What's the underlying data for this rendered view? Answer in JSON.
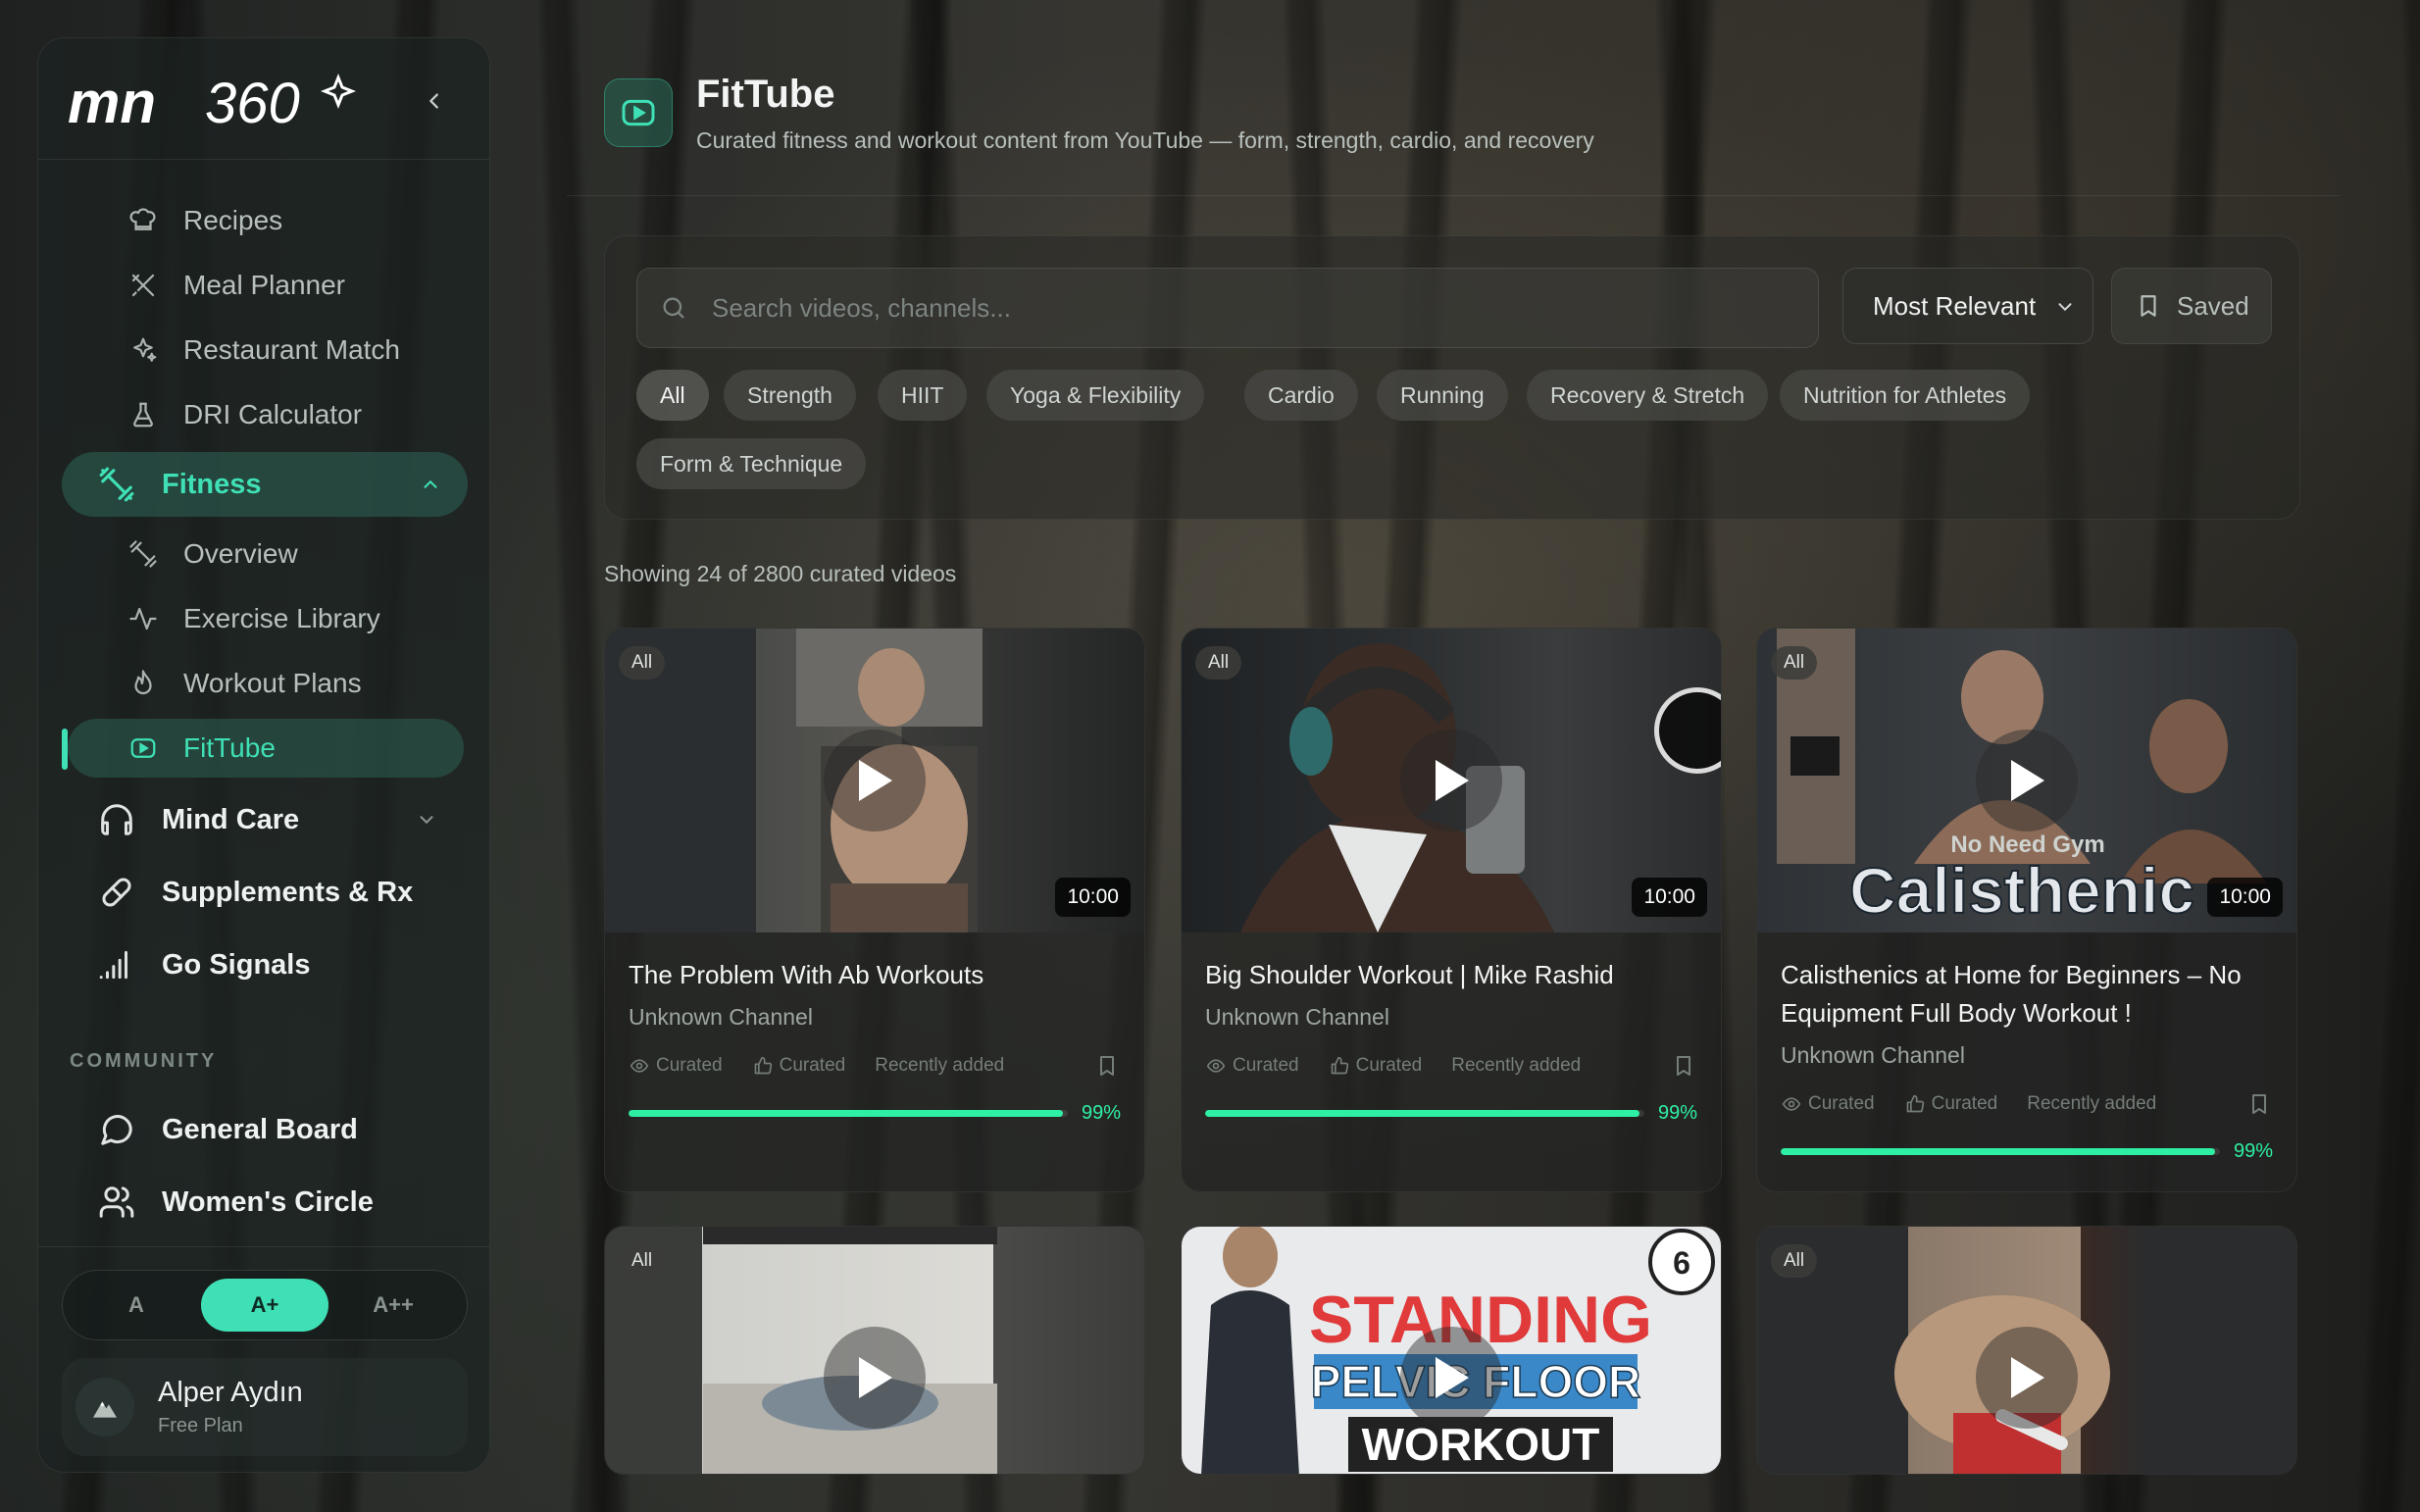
{
  "app": {
    "logo_text": "mn360",
    "brand_color": "#3fe0b5"
  },
  "sidebar": {
    "sub_items_top": [
      {
        "label": "Recipes",
        "icon": "chef-hat-icon"
      },
      {
        "label": "Meal Planner",
        "icon": "utensils-crossed-icon"
      },
      {
        "label": "Restaurant Match",
        "icon": "sparkles-icon"
      },
      {
        "label": "DRI Calculator",
        "icon": "flask-icon"
      }
    ],
    "fitness": {
      "label": "Fitness",
      "icon": "dumbbell-icon",
      "expanded": true
    },
    "fitness_items": [
      {
        "label": "Overview",
        "icon": "dumbbell-small-icon"
      },
      {
        "label": "Exercise Library",
        "icon": "activity-icon"
      },
      {
        "label": "Workout Plans",
        "icon": "flame-icon"
      },
      {
        "label": "FitTube",
        "icon": "youtube-icon",
        "active": true
      }
    ],
    "main_items": [
      {
        "label": "Mind Care",
        "icon": "headphones-icon",
        "has_chevron": true
      },
      {
        "label": "Supplements & Rx",
        "icon": "pill-icon"
      },
      {
        "label": "Go Signals",
        "icon": "signal-bars-icon"
      }
    ],
    "community_label": "COMMUNITY",
    "community_items": [
      {
        "label": "General Board",
        "icon": "message-circle-icon"
      },
      {
        "label": "Women's Circle",
        "icon": "users-icon"
      }
    ],
    "font_size_options": [
      "A",
      "A+",
      "A++"
    ],
    "font_size_selected": "A+",
    "user": {
      "name": "Alper Aydın",
      "plan": "Free Plan"
    }
  },
  "header": {
    "title": "FitTube",
    "subtitle": "Curated fitness and workout content from YouTube — form, strength, cardio, and recovery",
    "icon": "youtube-icon"
  },
  "filters": {
    "search_placeholder": "Search videos, channels...",
    "sort_value": "Most Relevant",
    "saved_label": "Saved",
    "categories": [
      "All",
      "Strength",
      "HIIT",
      "Yoga & Flexibility",
      "Cardio",
      "Running",
      "Recovery & Stretch",
      "Nutrition for Athletes",
      "Form & Technique"
    ],
    "selected_category": "All"
  },
  "results": {
    "count_text": "Showing 24 of 2800 curated videos"
  },
  "videos": [
    {
      "badge": "All",
      "duration": "10:00",
      "title": "The Problem With Ab Workouts",
      "channel": "Unknown Channel",
      "views": "Curated",
      "likes": "Curated",
      "added": "Recently added",
      "progress": 0.99,
      "progress_label": "99%"
    },
    {
      "badge": "All",
      "duration": "10:00",
      "title": "Big Shoulder Workout | Mike Rashid",
      "channel": "Unknown Channel",
      "views": "Curated",
      "likes": "Curated",
      "added": "Recently added",
      "progress": 0.99,
      "progress_label": "99%"
    },
    {
      "badge": "All",
      "duration": "10:00",
      "title": "Calisthenics at Home for Beginners – No Equipment Full Body Workout !",
      "channel": "Unknown Channel",
      "views": "Curated",
      "likes": "Curated",
      "added": "Recently added",
      "progress": 0.99,
      "progress_label": "99%",
      "thumb_text": "Calisthenic",
      "thumb_subtext": "No Need Gym"
    },
    {
      "badge": "All"
    },
    {
      "badge": "",
      "thumb_text_lines": [
        "STANDING",
        "PELVIC FLOOR",
        "WORKOUT"
      ],
      "thumb_corner": "6"
    },
    {
      "badge": "All"
    }
  ]
}
